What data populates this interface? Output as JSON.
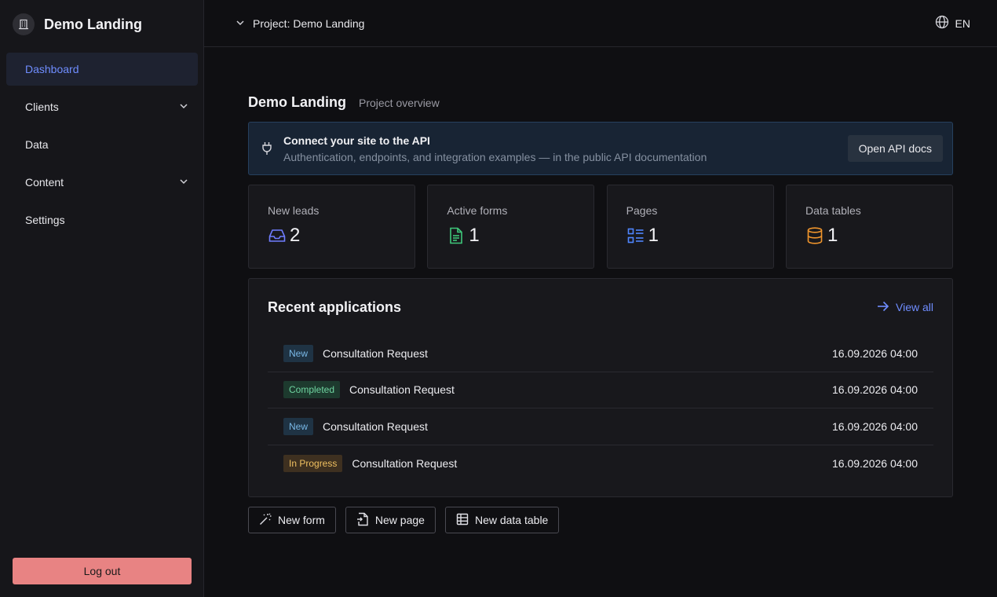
{
  "sidebar": {
    "brand": "Demo Landing",
    "logo_icon": "building-icon",
    "items": [
      {
        "label": "Dashboard",
        "active": true
      },
      {
        "label": "Clients",
        "expandable": true
      },
      {
        "label": "Data"
      },
      {
        "label": "Content",
        "expandable": true
      },
      {
        "label": "Settings"
      }
    ],
    "logout_label": "Log out"
  },
  "topbar": {
    "project": "Project: Demo Landing",
    "lang": "EN"
  },
  "main": {
    "title": "Demo Landing",
    "subtitle": "Project overview",
    "api_banner": {
      "title": "Connect your site to the API",
      "desc": "Authentication, endpoints, and integration examples — in the public API documentation",
      "button": "Open API docs"
    },
    "stats": [
      {
        "label": "New leads",
        "value": "2",
        "icon": "inbox-icon",
        "color": "#6f7dff"
      },
      {
        "label": "Active forms",
        "value": "1",
        "icon": "file-text-icon",
        "color": "#3fc77a"
      },
      {
        "label": "Pages",
        "value": "1",
        "icon": "list-icon",
        "color": "#4f86ff"
      },
      {
        "label": "Data tables",
        "value": "1",
        "icon": "database-icon",
        "color": "#f0952c"
      }
    ],
    "recent": {
      "title": "Recent applications",
      "view_all": "View all",
      "rows": [
        {
          "status": "New",
          "name": "Consultation Request",
          "date": "16.09.2026 04:00"
        },
        {
          "status": "Completed",
          "name": "Consultation Request",
          "date": "16.09.2026 04:00"
        },
        {
          "status": "New",
          "name": "Consultation Request",
          "date": "16.09.2026 04:00"
        },
        {
          "status": "In Progress",
          "name": "Consultation Request",
          "date": "16.09.2026 04:00"
        }
      ]
    },
    "actions": [
      {
        "label": "New form",
        "icon": "magic-wand-icon"
      },
      {
        "label": "New page",
        "icon": "file-plus-icon"
      },
      {
        "label": "New data table",
        "icon": "table-icon"
      }
    ]
  }
}
